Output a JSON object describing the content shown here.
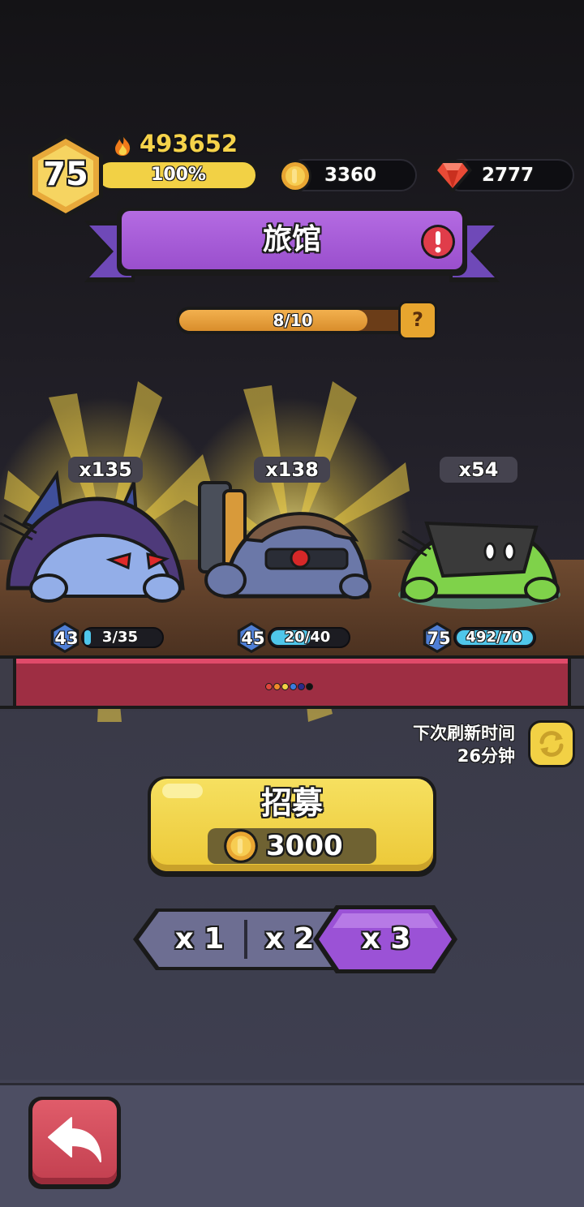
{
  "player": {
    "level": "75",
    "power": "493652",
    "xp_percent_label": "100%",
    "xp_fraction": 1.0
  },
  "resources": {
    "coins": "3360",
    "gems": "2777"
  },
  "banner": {
    "title": "旅馆"
  },
  "capacity": {
    "label": "8/10",
    "current": 8,
    "max": 10,
    "help_label": "?"
  },
  "heroes": [
    {
      "count": "x135",
      "level": "43",
      "exp": "3/35",
      "exp_fraction": 0.086
    },
    {
      "count": "x138",
      "level": "45",
      "exp": "20/40",
      "exp_fraction": 0.5
    },
    {
      "count": "x54",
      "level": "75",
      "exp": "492/70",
      "exp_fraction": 1.0
    }
  ],
  "page_dots": [
    "#e0463c",
    "#f08a2a",
    "#f2d145",
    "#3b7be0",
    "#2a2a8a",
    "#111111"
  ],
  "refresh": {
    "line1": "下次刷新时间",
    "line2": "26分钟"
  },
  "recruit": {
    "title": "招募",
    "cost": "3000"
  },
  "multipliers": {
    "options": [
      "x 1",
      "x 2",
      "x 3"
    ],
    "selected": "x 3"
  },
  "colors": {
    "gold": "#f2d145",
    "banner_purple": "#a95bd8",
    "level_blue": "#4f7fd6",
    "back_red": "#d04e5e"
  }
}
